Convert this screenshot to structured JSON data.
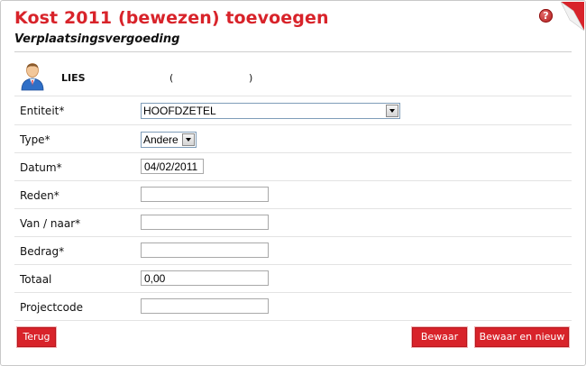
{
  "header": {
    "title": "Kost 2011 (bewezen) toevoegen",
    "subtitle": "Verplaatsingsvergoeding",
    "help_glyph": "?",
    "help_icon": "help-icon",
    "corner_icon": "page-curl-icon"
  },
  "user": {
    "name": "LIES",
    "paren_open": "(",
    "paren_close": ")"
  },
  "form": {
    "entiteit": {
      "label": "Entiteit*",
      "value": "HOOFDZETEL"
    },
    "type": {
      "label": "Type*",
      "value": "Andere"
    },
    "datum": {
      "label": "Datum*",
      "value": "04/02/2011"
    },
    "reden": {
      "label": "Reden*",
      "value": ""
    },
    "van_naar": {
      "label": "Van / naar*",
      "value": ""
    },
    "bedrag": {
      "label": "Bedrag*",
      "value": ""
    },
    "totaal": {
      "label": "Totaal",
      "value": "0,00"
    },
    "projectcode": {
      "label": "Projectcode",
      "value": ""
    }
  },
  "buttons": {
    "back": "Terug",
    "save": "Bewaar",
    "save_new": "Bewaar en nieuw"
  },
  "colors": {
    "accent": "#d8232a",
    "text": "#111111",
    "divider": "#e3e3e3"
  }
}
